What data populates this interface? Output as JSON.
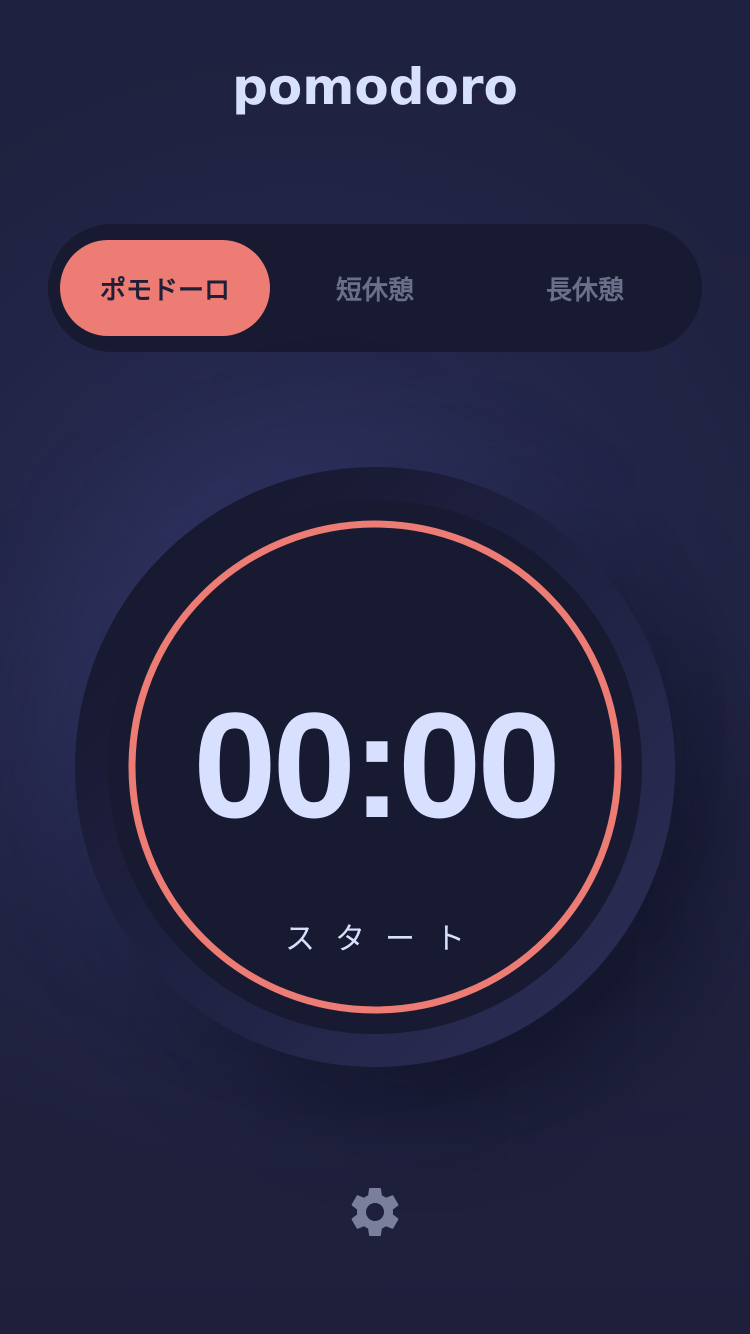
{
  "app": {
    "title": "pomodoro"
  },
  "modes": [
    {
      "label": "ポモドーロ",
      "active": true
    },
    {
      "label": "短休憩",
      "active": false
    },
    {
      "label": "長休憩",
      "active": false
    }
  ],
  "timer": {
    "time": "00:00",
    "action_label": "スタート",
    "progress": 1.0
  },
  "icons": {
    "settings": "gear-icon"
  },
  "colors": {
    "accent": "#ec7c74",
    "background": "#1f2140",
    "text": "#d7e0fe",
    "muted": "#6b6f8a",
    "icon": "#7a7f9c"
  }
}
